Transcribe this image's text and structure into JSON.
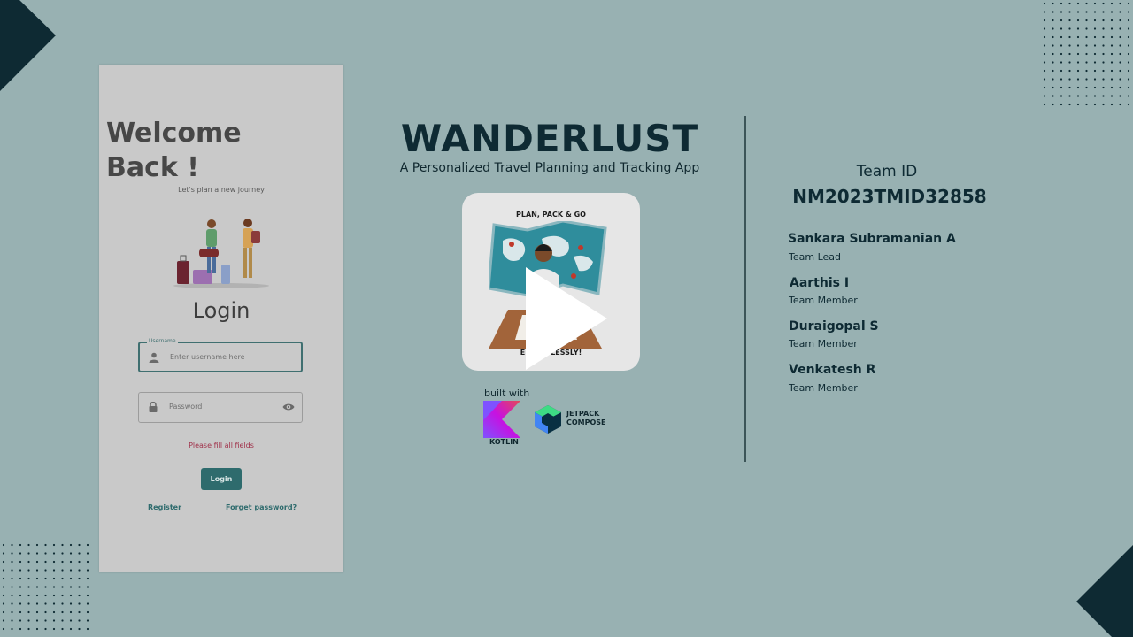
{
  "phone": {
    "welcome_line1": "Welcome",
    "welcome_line2": "Back !",
    "tagline": "Let's plan a new journey",
    "login_title": "Login",
    "username_label": "Username",
    "username_placeholder": "Enter username here",
    "password_placeholder": "Password",
    "error_text": "Please fill all fields",
    "login_button": "Login",
    "register_link": "Register",
    "forgot_link": "Forget password?"
  },
  "center": {
    "title": "WANDERLUST",
    "subtitle": "A Personalized Travel Planning and Tracking App",
    "video_top_text": "PLAN, PACK & GO",
    "video_bottom_text": "EFFORTLESSLY!",
    "built_with": "built with",
    "kotlin_label": "KOTLIN",
    "jetpack_label_1": "JETPACK",
    "jetpack_label_2": "COMPOSE"
  },
  "team": {
    "id_label": "Team ID",
    "id_value": "NM2023TMID32858",
    "members": [
      {
        "name": "Sankara Subramanian A",
        "role": "Team Lead"
      },
      {
        "name": "Aarthis I",
        "role": "Team Member"
      },
      {
        "name": "Duraigopal S",
        "role": "Team Member"
      },
      {
        "name": "Venkatesh R",
        "role": "Team Member"
      }
    ]
  },
  "colors": {
    "background": "#98b1b2",
    "dark_accent": "#0e2a33",
    "teal_button": "#2e6b6d",
    "error": "#a0314a"
  }
}
